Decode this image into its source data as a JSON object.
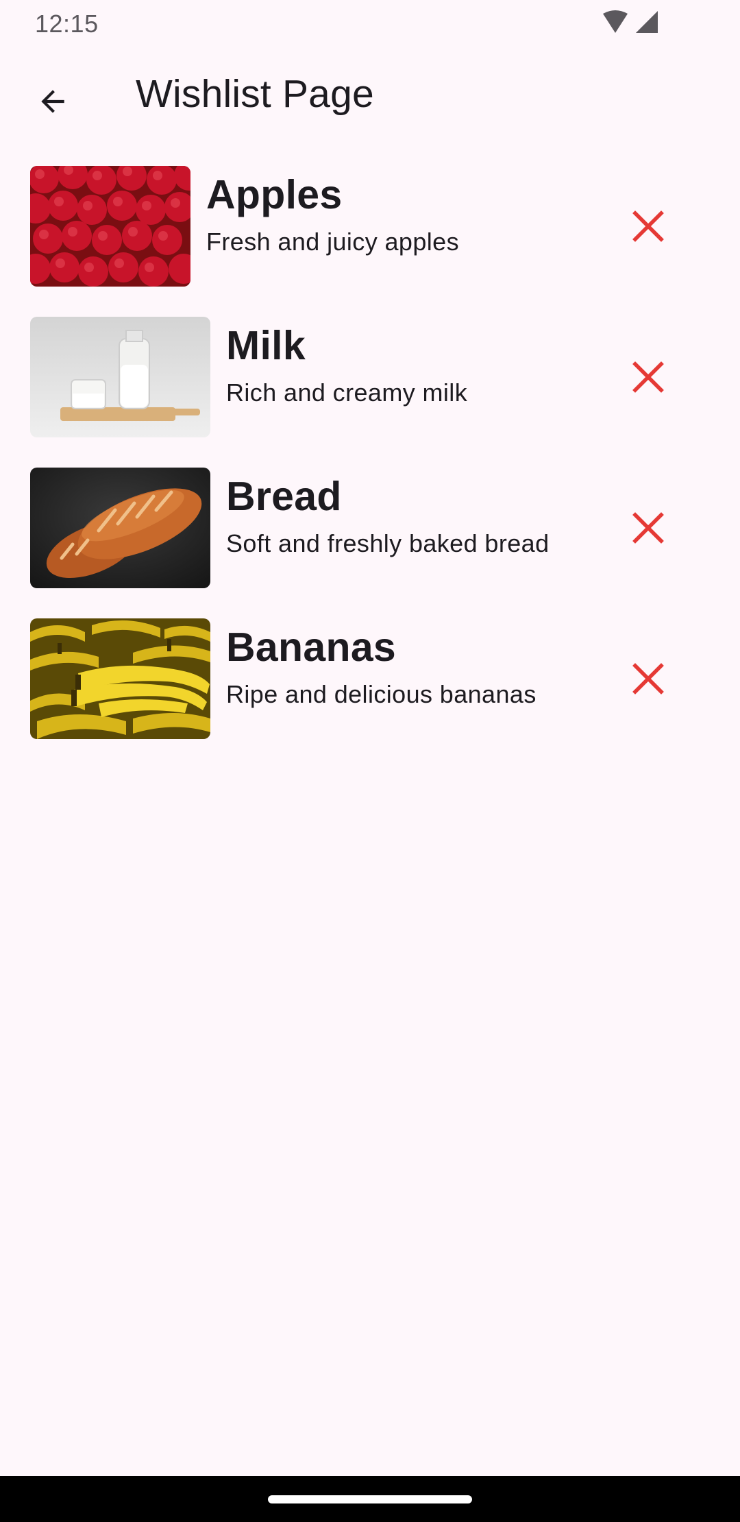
{
  "status_bar": {
    "time": "12:15",
    "icons": [
      "wifi-icon",
      "cell-signal-icon"
    ]
  },
  "app_bar": {
    "back_icon": "arrow-back-icon",
    "title": "Wishlist Page"
  },
  "wishlist": {
    "items": [
      {
        "name": "Apples",
        "description": "Fresh and juicy apples",
        "image": "apples-photo",
        "remove_icon": "close-icon"
      },
      {
        "name": "Milk",
        "description": "Rich and creamy milk",
        "image": "milk-photo",
        "remove_icon": "close-icon"
      },
      {
        "name": "Bread",
        "description": "Soft and freshly baked bread",
        "image": "bread-photo",
        "remove_icon": "close-icon"
      },
      {
        "name": "Bananas",
        "description": "Ripe and delicious bananas",
        "image": "bananas-photo",
        "remove_icon": "close-icon"
      }
    ]
  },
  "colors": {
    "background": "#fef7fb",
    "remove_accent": "#e53935",
    "text": "#1d1b20",
    "nav_bar": "#000000"
  }
}
